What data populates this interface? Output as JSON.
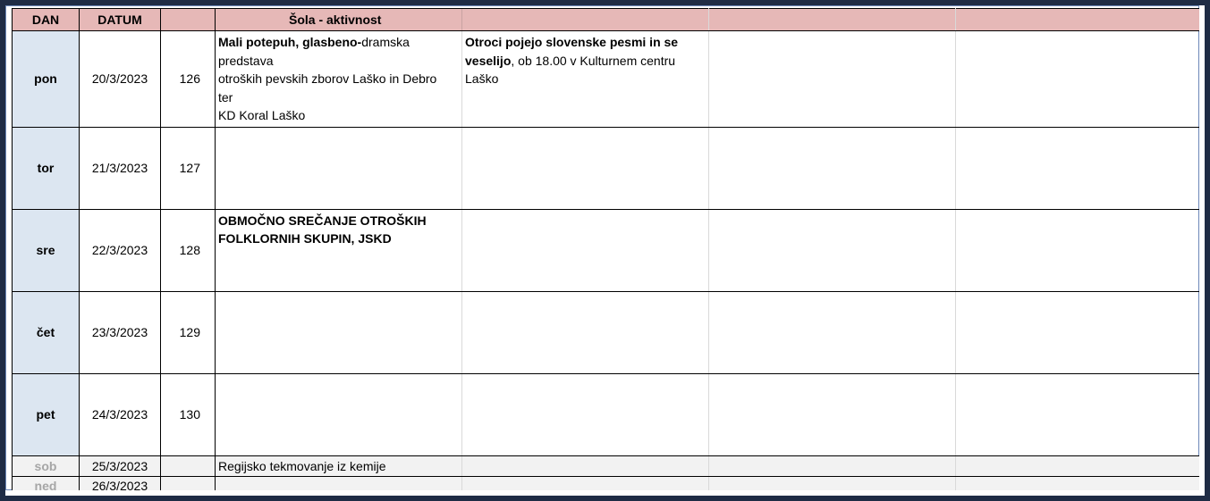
{
  "header": {
    "dan": "DAN",
    "datum": "DATUM",
    "title": "Šola - aktivnost"
  },
  "days": [
    {
      "dan": "pon",
      "datum": "20/3/2023",
      "num": "126",
      "cell1": {
        "bold": "Mali potepuh, glasbeno-",
        "normal": "dramska predstava",
        "lines": [
          "otroških pevskih zborov Laško in Debro",
          "ter",
          "KD Koral Laško"
        ]
      },
      "cell2": {
        "bold": "Otroci pojejo slovenske pesmi in se veselijo",
        "normal": ", ob 18.00 v Kulturnem centru Laško"
      }
    },
    {
      "dan": "tor",
      "datum": "21/3/2023",
      "num": "127"
    },
    {
      "dan": "sre",
      "datum": "22/3/2023",
      "num": "128",
      "cell1": {
        "bold": "OBMOČNO SREČANJE OTROŠKIH FOLKLORNIH SKUPIN, JSKD"
      }
    },
    {
      "dan": "čet",
      "datum": "23/3/2023",
      "num": "129"
    },
    {
      "dan": "pet",
      "datum": "24/3/2023",
      "num": "130"
    }
  ],
  "weekend": [
    {
      "dan": "sob",
      "datum": "25/3/2023",
      "num": "",
      "cell1": "Regijsko tekmovanje iz kemije"
    },
    {
      "dan": "ned",
      "datum": "26/3/2023",
      "num": "",
      "cell1": ""
    }
  ]
}
